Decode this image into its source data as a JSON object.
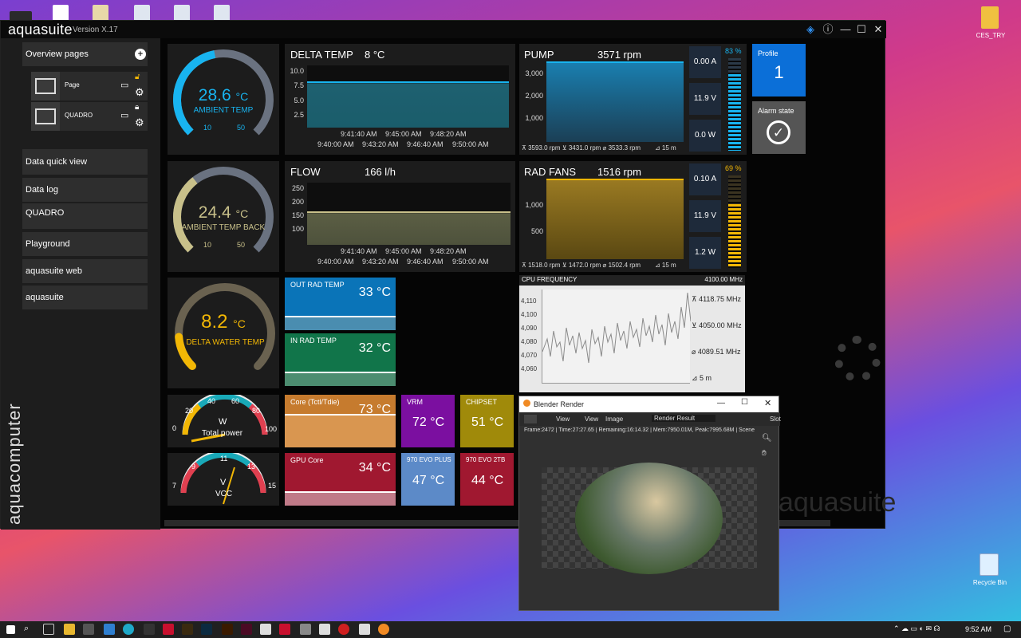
{
  "app": {
    "title": "aquasuite",
    "version": "Version X.17",
    "brand_vertical": "aquacomputer",
    "watermark": "aquasuite"
  },
  "sidebar": {
    "overview_label": "Overview pages",
    "pages": [
      {
        "label": "Page"
      },
      {
        "label": "QUADRO"
      }
    ],
    "items": [
      {
        "label": "Data quick view"
      },
      {
        "label": "Data log"
      },
      {
        "label": "QUADRO"
      },
      {
        "label": "Playground"
      },
      {
        "label": "aquasuite web"
      },
      {
        "label": "aquasuite"
      }
    ]
  },
  "gauges": [
    {
      "value": "28.6",
      "unit": "°C",
      "label": "AMBIENT TEMP",
      "min": "10",
      "max": "50",
      "color": "#18b4f0",
      "fraction": 0.46
    },
    {
      "value": "24.4",
      "unit": "°C",
      "label": "AMBIENT TEMP BACK",
      "min": "10",
      "max": "50",
      "color": "#c8c08a",
      "fraction": 0.36
    },
    {
      "value": "8.2",
      "unit": "°C",
      "label": "DELTA WATER TEMP",
      "color": "#f2b705",
      "fraction": 0.15
    }
  ],
  "delta_temp": {
    "title": "DELTA TEMP",
    "value": "8 °C",
    "yticks": [
      "10.0",
      "7.5",
      "5.0",
      "2.5"
    ],
    "times_top": [
      "9:41:40 AM",
      "9:45:00 AM",
      "9:48:20 AM"
    ],
    "times_bottom": [
      "9:40:00 AM",
      "9:43:20 AM",
      "9:46:40 AM",
      "9:50:00 AM"
    ]
  },
  "flow": {
    "title": "FLOW",
    "value": "166 l/h",
    "yticks": [
      "250",
      "200",
      "150",
      "100"
    ],
    "times_top": [
      "9:41:40 AM",
      "9:45:00 AM",
      "9:48:20 AM"
    ],
    "times_bottom": [
      "9:40:00 AM",
      "9:43:20 AM",
      "9:46:40 AM",
      "9:50:00 AM"
    ]
  },
  "pump": {
    "title": "PUMP",
    "value": "3571 rpm",
    "yticks": [
      "3,000",
      "2,000",
      "1,000"
    ],
    "stats": "⊼ 3593.0 rpm  ⊻ 3431.0 rpm  ⌀ 3533.3 rpm",
    "span": "⊿ 15 m",
    "current": "0.00 A",
    "voltage": "11.9 V",
    "power": "0.0 W",
    "percent": "83 %",
    "percent_value": 83
  },
  "rad_fans": {
    "title": "RAD FANS",
    "value": "1516 rpm",
    "yticks": [
      "1,000",
      "500"
    ],
    "stats": "⊼ 1518.0 rpm  ⊻ 1472.0 rpm  ⌀ 1502.4 rpm",
    "span": "⊿ 15 m",
    "current": "0.10 A",
    "voltage": "11.9 V",
    "power": "1.2 W",
    "percent": "69 %",
    "percent_value": 69
  },
  "profile": {
    "label": "Profile",
    "value": "1"
  },
  "alarm": {
    "label": "Alarm state"
  },
  "cpu": {
    "title": "CPU FREQUENCY",
    "value": "4100.00 MHz",
    "yticks": [
      "4,110",
      "4,100",
      "4,090",
      "4,080",
      "4,070",
      "4,060"
    ],
    "max": "⊼ 4118.75 MHz",
    "min": "⊻ 4050.00 MHz",
    "avg": "⌀ 4089.51 MHz",
    "span": "⊿ 5 m"
  },
  "sensors": {
    "out_rad": {
      "title": "OUT RAD TEMP",
      "value": "33 °C"
    },
    "in_rad": {
      "title": "IN RAD TEMP",
      "value": "32 °C"
    },
    "core": {
      "title": "Core (Tctl/Tdie)",
      "value": "73 °C"
    },
    "vrm": {
      "title": "VRM",
      "value": "72 °C"
    },
    "chipset": {
      "title": "CHIPSET",
      "value": "51 °C"
    },
    "gpu": {
      "title": "GPU Core",
      "value": "34 °C"
    },
    "evo_plus": {
      "title": "970 EVO PLUS",
      "value": "47 °C"
    },
    "evo_2tb": {
      "title": "970 EVO 2TB",
      "value": "44 °C"
    }
  },
  "power_gauge": {
    "unit": "W",
    "label": "Total power",
    "ticks": [
      "0",
      "20",
      "40",
      "60",
      "80",
      "100"
    ]
  },
  "vcc_gauge": {
    "unit": "V",
    "label": "VCC",
    "ticks": [
      "7",
      "9",
      "11",
      "13",
      "15"
    ]
  },
  "blender": {
    "title": "Blender Render",
    "menu_view": "View",
    "menu_view2": "View",
    "menu_image": "Image",
    "render_result": "Render Result",
    "slot": "Slot",
    "status": "Frame:2472 | Time:27:27.65 | Remaining:16:14.32 | Mem:7950.01M, Peak:7995.68M | Scene"
  },
  "desktop": {
    "icon1": "CES_TRY",
    "icon2": "Recycle Bin"
  },
  "taskbar": {
    "time": "9:52 AM"
  }
}
